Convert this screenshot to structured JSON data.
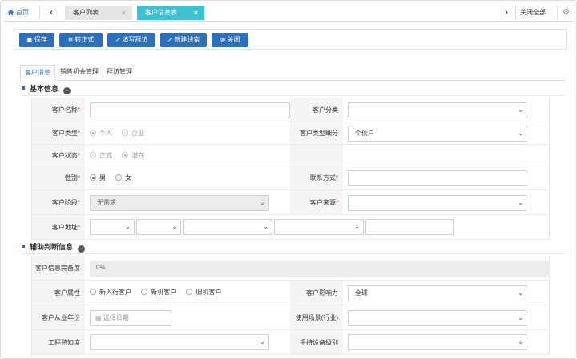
{
  "tabbar": {
    "home_label": "首页",
    "prev": "‹",
    "next": "›",
    "tabs": [
      {
        "label": "客户列表",
        "close": "×"
      },
      {
        "label": "客户信息表",
        "close": "×"
      }
    ],
    "close_all": "关闭全部",
    "settings_icon": "gear-icon"
  },
  "toolbar": {
    "buttons": [
      {
        "label": "保存",
        "icon": "save-icon"
      },
      {
        "label": "转正式",
        "icon": "gear-icon"
      },
      {
        "label": "填写拜访",
        "icon": "edit-icon"
      },
      {
        "label": "新建线索",
        "icon": "edit-icon"
      },
      {
        "label": "关闭",
        "icon": "close-circle-icon"
      }
    ]
  },
  "subtabs": [
    "客户消息",
    "销售机会管理",
    "拜访管理"
  ],
  "basic": {
    "title": "基本信息",
    "name_label": "客户名称",
    "category_label": "客户分类",
    "type_label": "客户类型",
    "type_options": [
      "个人",
      "企业"
    ],
    "type_sub_label": "客户类型细分",
    "type_sub_value": "个伙户",
    "status_label": "客户状态",
    "status_options": [
      "正式",
      "潜在"
    ],
    "gender_label": "性别",
    "gender_options": [
      "男",
      "女"
    ],
    "contact_label": "联系方式",
    "stage_label": "客户阶段",
    "stage_value": "无需求",
    "source_label": "客户来源",
    "address_label": "客户地址"
  },
  "aux": {
    "title": "辅助判断信息",
    "completeness_label": "客户信息完备度",
    "completeness_value": "0%",
    "attr_label": "客户属性",
    "attr_options": [
      "新入行客户",
      "新机客户",
      "旧机客户"
    ],
    "influence_label": "客户影响力",
    "influence_value": "全球",
    "years_label": "客户从业年份",
    "date_placeholder": "选择日期",
    "scene_label": "使用场景(行业)",
    "engineering_label": "工程熟知度",
    "equipment_label": "手持设备级别"
  },
  "colors": {
    "primary": "#2d6fb8",
    "active_tab": "#3ec1d3",
    "required": "#e02020"
  }
}
